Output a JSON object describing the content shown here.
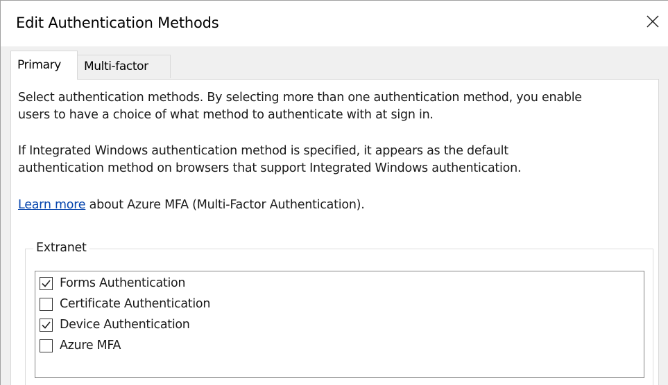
{
  "window": {
    "title": "Edit Authentication Methods",
    "close_icon": "close-icon"
  },
  "tabs": [
    {
      "label": "Primary",
      "selected": true
    },
    {
      "label": "Multi-factor",
      "selected": false
    }
  ],
  "content": {
    "description_line1": "Select authentication methods. By selecting more than one authentication method, you enable",
    "description_line2": "users to have a choice of what method to authenticate with at sign in.",
    "integrated_line1": "If Integrated Windows authentication method is specified, it appears as the default",
    "integrated_line2": "authentication method on browsers that support Integrated Windows authentication.",
    "learn_more_link": "Learn more",
    "learn_more_suffix": " about Azure MFA (Multi-Factor Authentication)."
  },
  "extranet": {
    "group_label": "Extranet",
    "methods": [
      {
        "label": "Forms Authentication",
        "checked": true
      },
      {
        "label": "Certificate Authentication",
        "checked": false
      },
      {
        "label": "Device Authentication",
        "checked": true
      },
      {
        "label": "Azure MFA",
        "checked": false
      }
    ]
  },
  "colors": {
    "link": "#0645ad",
    "dialog_bg": "#f0f0f0",
    "panel_bg": "#ffffff"
  }
}
